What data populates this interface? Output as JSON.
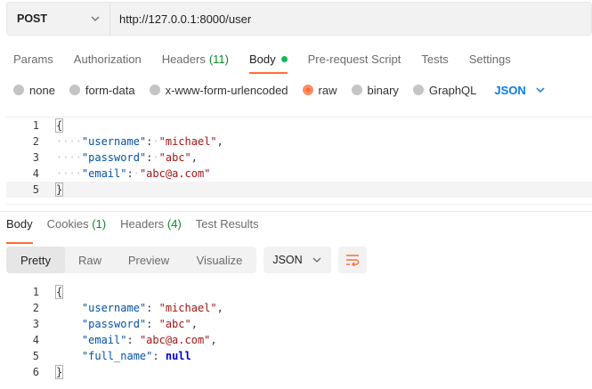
{
  "request": {
    "method": "POST",
    "url": "http://127.0.0.1:8000/user"
  },
  "req_tabs": [
    {
      "label": "Params"
    },
    {
      "label": "Authorization"
    },
    {
      "label": "Headers",
      "count": "(11)"
    },
    {
      "label": "Body"
    },
    {
      "label": "Pre-request Script"
    },
    {
      "label": "Tests"
    },
    {
      "label": "Settings"
    }
  ],
  "body_types": {
    "none": "none",
    "form_data": "form-data",
    "urlencoded": "x-www-form-urlencoded",
    "raw": "raw",
    "binary": "binary",
    "graphql": "GraphQL",
    "language": "JSON"
  },
  "request_body": {
    "line_numbers": [
      "1",
      "2",
      "3",
      "4",
      "5"
    ],
    "open_brace": "{",
    "close_brace": "}",
    "pairs": [
      {
        "key": "\"username\"",
        "sep": ":",
        "value": "\"michael\"",
        "comma": ","
      },
      {
        "key": "\"password\"",
        "sep": ":",
        "value": "\"abc\"",
        "comma": ","
      },
      {
        "key": "\"email\"",
        "sep": ":",
        "value": "\"abc@a.com\"",
        "comma": ""
      }
    ]
  },
  "resp_tabs": [
    {
      "label": "Body"
    },
    {
      "label": "Cookies",
      "count": "(1)"
    },
    {
      "label": "Headers",
      "count": "(4)"
    },
    {
      "label": "Test Results"
    }
  ],
  "view_modes": {
    "pretty": "Pretty",
    "raw": "Raw",
    "preview": "Preview",
    "visualize": "Visualize"
  },
  "response_format": "JSON",
  "response_body": {
    "line_numbers": [
      "1",
      "2",
      "3",
      "4",
      "5",
      "6"
    ],
    "open_brace": "{",
    "close_brace": "}",
    "pairs": [
      {
        "key": "\"username\"",
        "value": "\"michael\"",
        "comma": ","
      },
      {
        "key": "\"password\"",
        "value": "\"abc\"",
        "comma": ","
      },
      {
        "key": "\"email\"",
        "value": "\"abc@a.com\"",
        "comma": ","
      },
      {
        "key": "\"full_name\"",
        "value": "null",
        "comma": ""
      }
    ]
  },
  "colors": {
    "accent": "#ff6c37",
    "link": "#097bed",
    "count": "#0a8a29",
    "status_dot": "#0cbb52"
  },
  "icons": {
    "method_dropdown": "chevron-down-icon",
    "language_dropdown": "chevron-down-icon",
    "format_dropdown": "chevron-down-icon",
    "wrap": "wrap-lines-icon"
  }
}
